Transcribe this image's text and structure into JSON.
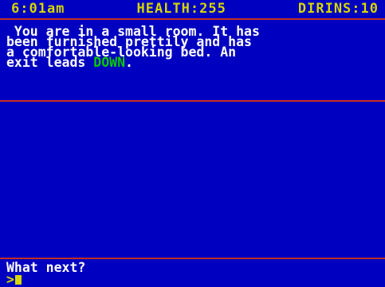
{
  "status": {
    "time": "6:01am",
    "health": "HEALTH:255",
    "dirins": "DIRINS:10"
  },
  "room": {
    "lines": [
      " You are in a small room. It has",
      "been furnished prettily and has",
      "a comfortable-looking bed. An",
      "exit leads "
    ],
    "exit_word": "DOWN",
    "exit_suffix": "."
  },
  "prompt": {
    "question": "What next?",
    "input_marker": ">"
  },
  "colors": {
    "background": "#0000c0",
    "status_text": "#d6d600",
    "body_text": "#ffffff",
    "exit_highlight": "#00cc00",
    "divider": "#c03020"
  }
}
